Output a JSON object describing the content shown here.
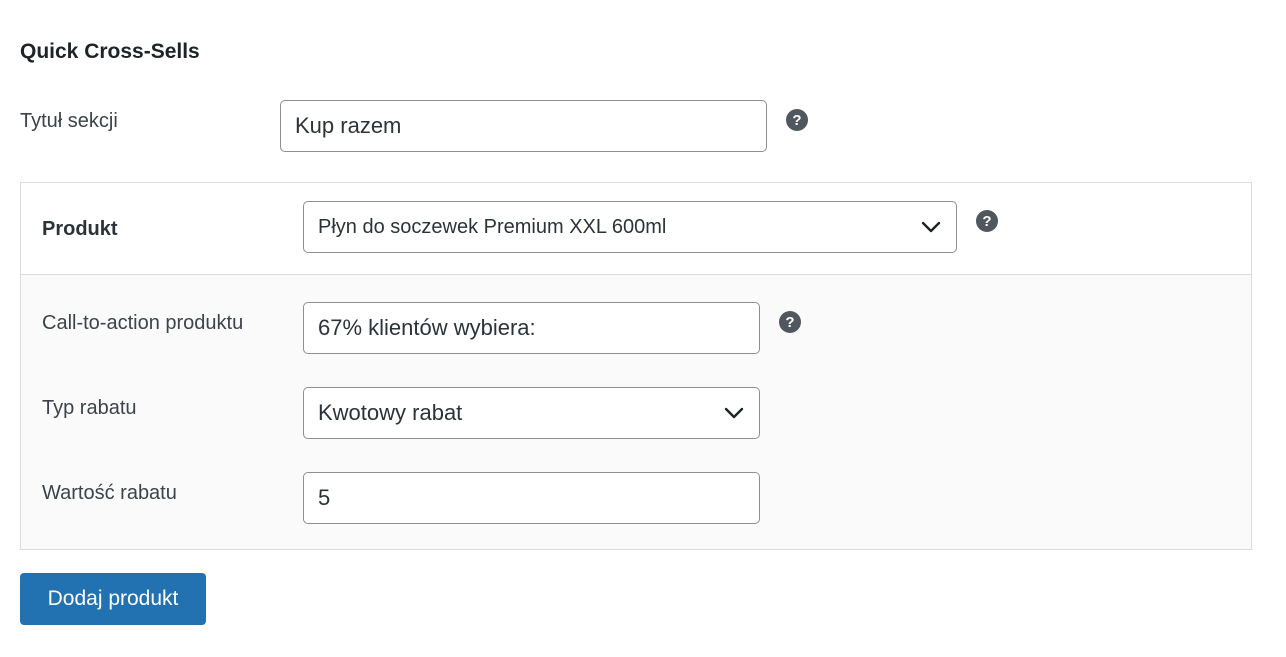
{
  "section": {
    "title": "Quick Cross-Sells"
  },
  "section_title_field": {
    "label": "Tytuł sekcji",
    "value": "Kup razem",
    "help": "?"
  },
  "product": {
    "label": "Produkt",
    "selected": "Płyn do soczewek Premium XXL 600ml",
    "help": "?",
    "cta": {
      "label": "Call-to-action produktu",
      "value": "67% klientów wybiera:",
      "help": "?"
    },
    "discount_type": {
      "label": "Typ rabatu",
      "selected": "Kwotowy rabat"
    },
    "discount_value": {
      "label": "Wartość rabatu",
      "value": "5"
    }
  },
  "actions": {
    "add_product_label": "Dodaj produkt"
  },
  "colors": {
    "primary": "#2271b1",
    "help_icon": "#50575e",
    "border": "#8c8f94",
    "panel_bg": "#fafafa"
  },
  "icons": {
    "help": "question-circle-icon",
    "dropdown": "chevron-down-icon"
  }
}
